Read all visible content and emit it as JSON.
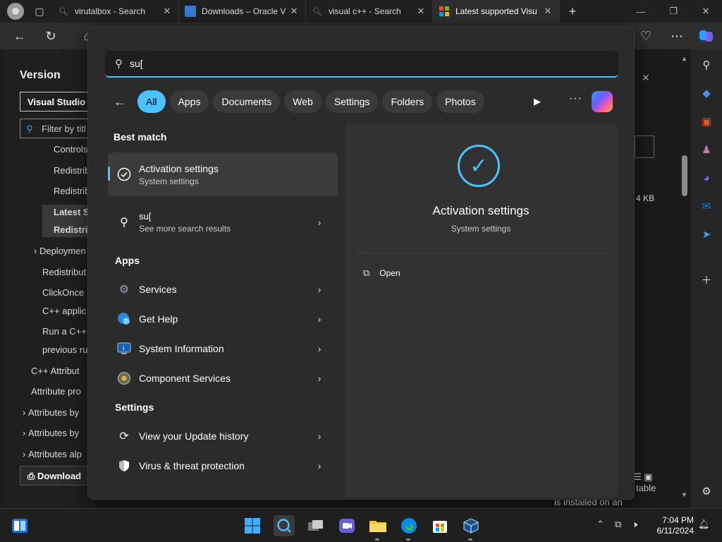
{
  "browser": {
    "tabs": [
      {
        "title": "virutalbox - Search",
        "icon": "search-icon"
      },
      {
        "title": "Downloads – Oracle V",
        "icon": "oracle-icon"
      },
      {
        "title": "visual c++ - Search",
        "icon": "search-icon"
      },
      {
        "title": "Latest supported Visu",
        "icon": "microsoft-icon"
      }
    ],
    "new_tab": "+"
  },
  "page": {
    "version_label": "Version",
    "version_select": "Visual Studio",
    "filter_placeholder": "Filter by titl",
    "nav": [
      "Controls",
      "Redistrib",
      "Redistrib",
      "Latest S",
      "Redistrib",
      "Deploymen",
      "Redistribut",
      "ClickOnce",
      "C++ applic",
      "Run a C++",
      "previous ru",
      "C++ Attribut",
      "Attribute pro",
      "Attributes by",
      "Attributes by",
      "Attributes alp"
    ],
    "download": "Download",
    "size_fragment": "4 KB",
    "footer_text": "is installed on an",
    "footer_text2": "table"
  },
  "search": {
    "query": "su[",
    "filters": [
      "All",
      "Apps",
      "Documents",
      "Web",
      "Settings",
      "Folders",
      "Photos"
    ],
    "best_match_title": "Best match",
    "best_match": {
      "title": "Activation settings",
      "subtitle": "System settings"
    },
    "web_result": {
      "title": "su[",
      "subtitle": "See more search results"
    },
    "apps_title": "Apps",
    "apps": [
      "Services",
      "Get Help",
      "System Information",
      "Component Services"
    ],
    "settings_title": "Settings",
    "settings": [
      "View your Update history",
      "Virus & threat protection"
    ],
    "preview": {
      "title": "Activation settings",
      "subtitle": "System settings",
      "open": "Open"
    }
  },
  "taskbar": {
    "time": "7:04 PM",
    "date": "6/11/2024"
  },
  "colors": {
    "accent": "#4cc2ff"
  }
}
